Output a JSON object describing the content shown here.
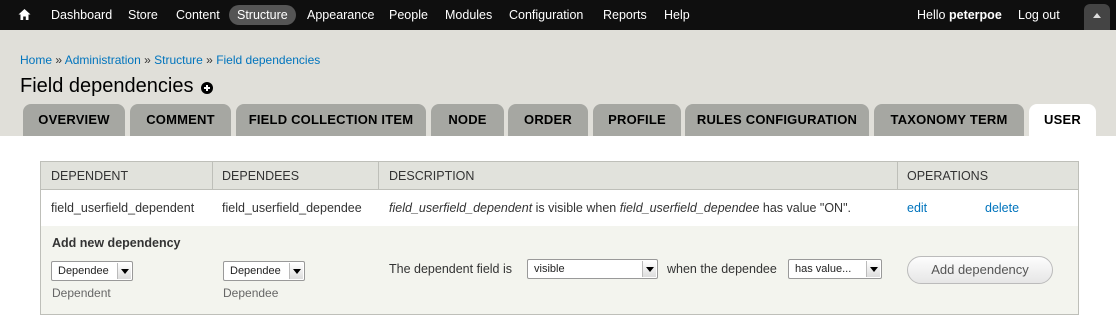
{
  "toolbar": {
    "items": [
      "Dashboard",
      "Store",
      "Content",
      "Structure",
      "Appearance",
      "People",
      "Modules",
      "Configuration",
      "Reports",
      "Help"
    ],
    "active": "Structure",
    "hello_prefix": "Hello",
    "username": "peterpoe",
    "logout": "Log out"
  },
  "breadcrumb": {
    "items": [
      "Home",
      "Administration",
      "Structure",
      "Field dependencies"
    ],
    "separator": "»"
  },
  "page_title": "Field dependencies",
  "tabs": [
    "OVERVIEW",
    "COMMENT",
    "FIELD COLLECTION ITEM",
    "NODE",
    "ORDER",
    "PROFILE",
    "RULES CONFIGURATION",
    "TAXONOMY TERM",
    "USER"
  ],
  "active_tab": "USER",
  "table": {
    "headers": [
      "DEPENDENT",
      "DEPENDEES",
      "DESCRIPTION",
      "OPERATIONS"
    ],
    "rows": [
      {
        "dependent": "field_userfield_dependent",
        "dependee": "field_userfield_dependee",
        "description": {
          "dependent": "field_userfield_dependent",
          "mid": " is visible when ",
          "dependee": "field_userfield_dependee",
          "tail": " has value \"ON\"."
        },
        "edit": "edit",
        "delete": "delete"
      }
    ],
    "add_new": {
      "title": "Add new dependency",
      "dependent_select": "Dependee",
      "dependent_desc": "Dependent",
      "dependee_select": "Dependee",
      "dependee_desc": "Dependee",
      "prefix": "The dependent field is",
      "state_select": "visible",
      "middle": "when the dependee",
      "condition_select": "has value...",
      "button": "Add dependency"
    }
  },
  "colors": {
    "toolbar_bg": "#0f0f0f",
    "header_bg": "#e0dfd9",
    "tab_bg": "#a6a7a2",
    "link": "#0074bd"
  }
}
